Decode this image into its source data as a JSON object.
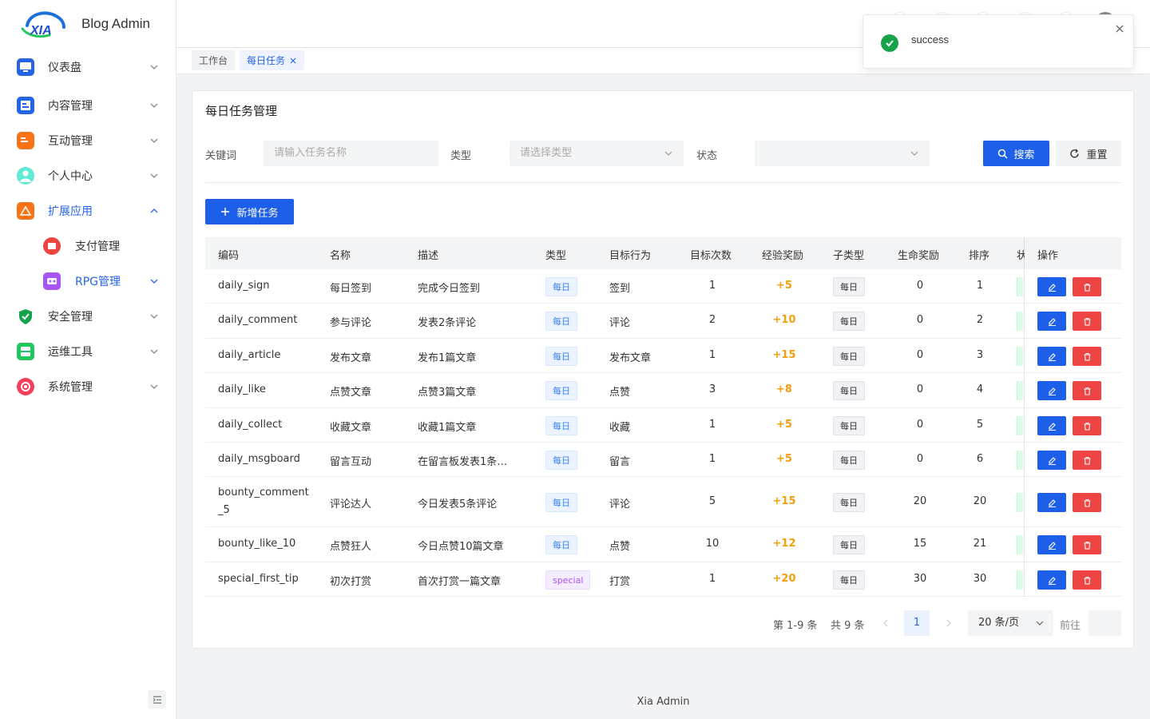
{
  "app": {
    "title": "Blog Admin",
    "logo_text": "XIA",
    "footer": "Xia Admin"
  },
  "colors": {
    "primary": "#1d5fe9",
    "danger": "#ef4444",
    "success": "#16a34a",
    "exp": "#f59e0b"
  },
  "sidebar": {
    "items": [
      {
        "label": "仪表盘",
        "icon": "monitor-icon"
      },
      {
        "label": "内容管理",
        "icon": "document-icon"
      },
      {
        "label": "互动管理",
        "icon": "chat-icon"
      },
      {
        "label": "个人中心",
        "icon": "user-icon"
      },
      {
        "label": "扩展应用",
        "icon": "apps-icon"
      },
      {
        "label": "支付管理",
        "icon": "wallet-icon"
      },
      {
        "label": "RPG管理",
        "icon": "game-icon"
      },
      {
        "label": "安全管理",
        "icon": "shield-icon"
      },
      {
        "label": "运维工具",
        "icon": "tools-icon"
      },
      {
        "label": "系统管理",
        "icon": "gear-icon"
      }
    ]
  },
  "tabs": [
    {
      "label": "工作台"
    },
    {
      "label": "每日任务"
    }
  ],
  "page": {
    "title": "每日任务管理"
  },
  "filters": {
    "keyword_label": "关键词",
    "keyword_placeholder": "请输入任务名称",
    "type_label": "类型",
    "type_placeholder": "请选择类型",
    "status_label": "状态",
    "status_value": "",
    "search": "搜索",
    "reset": "重置"
  },
  "add_button": "新增任务",
  "table": {
    "headers": [
      "编码",
      "名称",
      "描述",
      "类型",
      "目标行为",
      "目标次数",
      "经验奖励",
      "子类型",
      "生命奖励",
      "排序",
      "状",
      "操作"
    ],
    "rows": [
      {
        "code": "daily_sign",
        "name": "每日签到",
        "desc": "完成今日签到",
        "type": "每日",
        "action": "签到",
        "count": "1",
        "exp": "+5",
        "sub": "每日",
        "life": "0",
        "sort": "1"
      },
      {
        "code": "daily_comment",
        "name": "参与评论",
        "desc": "发表2条评论",
        "type": "每日",
        "action": "评论",
        "count": "2",
        "exp": "+10",
        "sub": "每日",
        "life": "0",
        "sort": "2"
      },
      {
        "code": "daily_article",
        "name": "发布文章",
        "desc": "发布1篇文章",
        "type": "每日",
        "action": "发布文章",
        "count": "1",
        "exp": "+15",
        "sub": "每日",
        "life": "0",
        "sort": "3"
      },
      {
        "code": "daily_like",
        "name": "点赞文章",
        "desc": "点赞3篇文章",
        "type": "每日",
        "action": "点赞",
        "count": "3",
        "exp": "+8",
        "sub": "每日",
        "life": "0",
        "sort": "4"
      },
      {
        "code": "daily_collect",
        "name": "收藏文章",
        "desc": "收藏1篇文章",
        "type": "每日",
        "action": "收藏",
        "count": "1",
        "exp": "+5",
        "sub": "每日",
        "life": "0",
        "sort": "5"
      },
      {
        "code": "daily_msgboard",
        "name": "留言互动",
        "desc": "在留言板发表1条…",
        "type": "每日",
        "action": "留言",
        "count": "1",
        "exp": "+5",
        "sub": "每日",
        "life": "0",
        "sort": "6"
      },
      {
        "code": "bounty_comment",
        "code2": "_5",
        "name": "评论达人",
        "desc": "今日发表5条评论",
        "type": "每日",
        "action": "评论",
        "count": "5",
        "exp": "+15",
        "sub": "每日",
        "life": "20",
        "sort": "20"
      },
      {
        "code": "bounty_like_10",
        "name": "点赞狂人",
        "desc": "今日点赞10篇文章",
        "type": "每日",
        "action": "点赞",
        "count": "10",
        "exp": "+12",
        "sub": "每日",
        "life": "15",
        "sort": "21"
      },
      {
        "code": "special_first_tip",
        "name": "初次打赏",
        "desc": "首次打赏一篇文章",
        "type": "special",
        "action": "打赏",
        "count": "1",
        "exp": "+20",
        "sub": "每日",
        "life": "30",
        "sort": "30"
      }
    ]
  },
  "pagination": {
    "range": "第 1-9 条",
    "total": "共 9 条",
    "current": "1",
    "page_size": "20 条/页",
    "goto": "前往"
  },
  "toast": {
    "message": "success"
  }
}
